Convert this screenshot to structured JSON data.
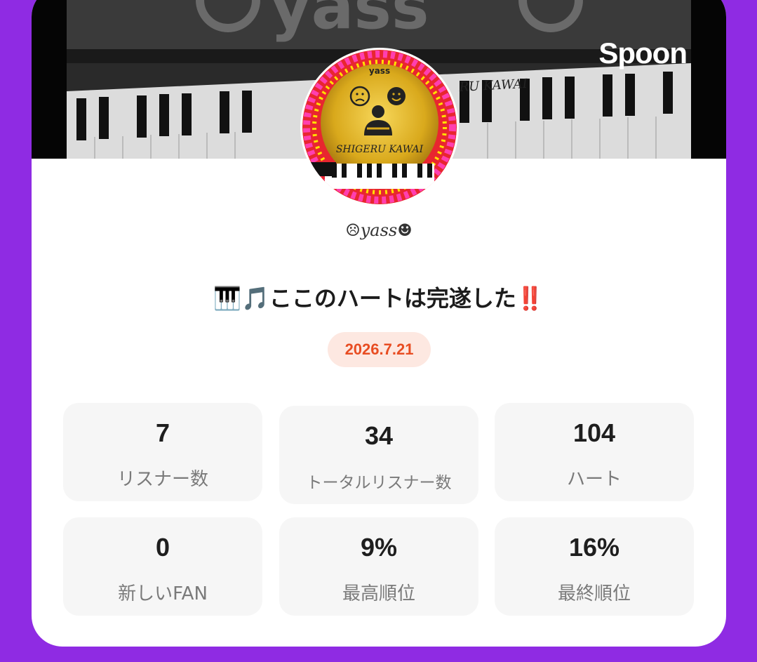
{
  "header": {
    "brand": "Spoon"
  },
  "profile": {
    "username": "☹yass☻"
  },
  "live": {
    "title": "🎹🎵ここのハートは完遂した‼️",
    "date": "2026.7.21"
  },
  "stats": [
    {
      "value": "7",
      "label": "リスナー数"
    },
    {
      "value": "34",
      "label": "トータルリスナー数"
    },
    {
      "value": "104",
      "label": "ハート"
    },
    {
      "value": "0",
      "label": "新しいFAN"
    },
    {
      "value": "9%",
      "label": "最高順位"
    },
    {
      "value": "16%",
      "label": "最終順位"
    }
  ],
  "colors": {
    "background": "#8f2be3",
    "card": "#ffffff",
    "date_text": "#e84d22",
    "date_bg": "#fde8e1",
    "stat_bg": "#f6f6f6"
  }
}
